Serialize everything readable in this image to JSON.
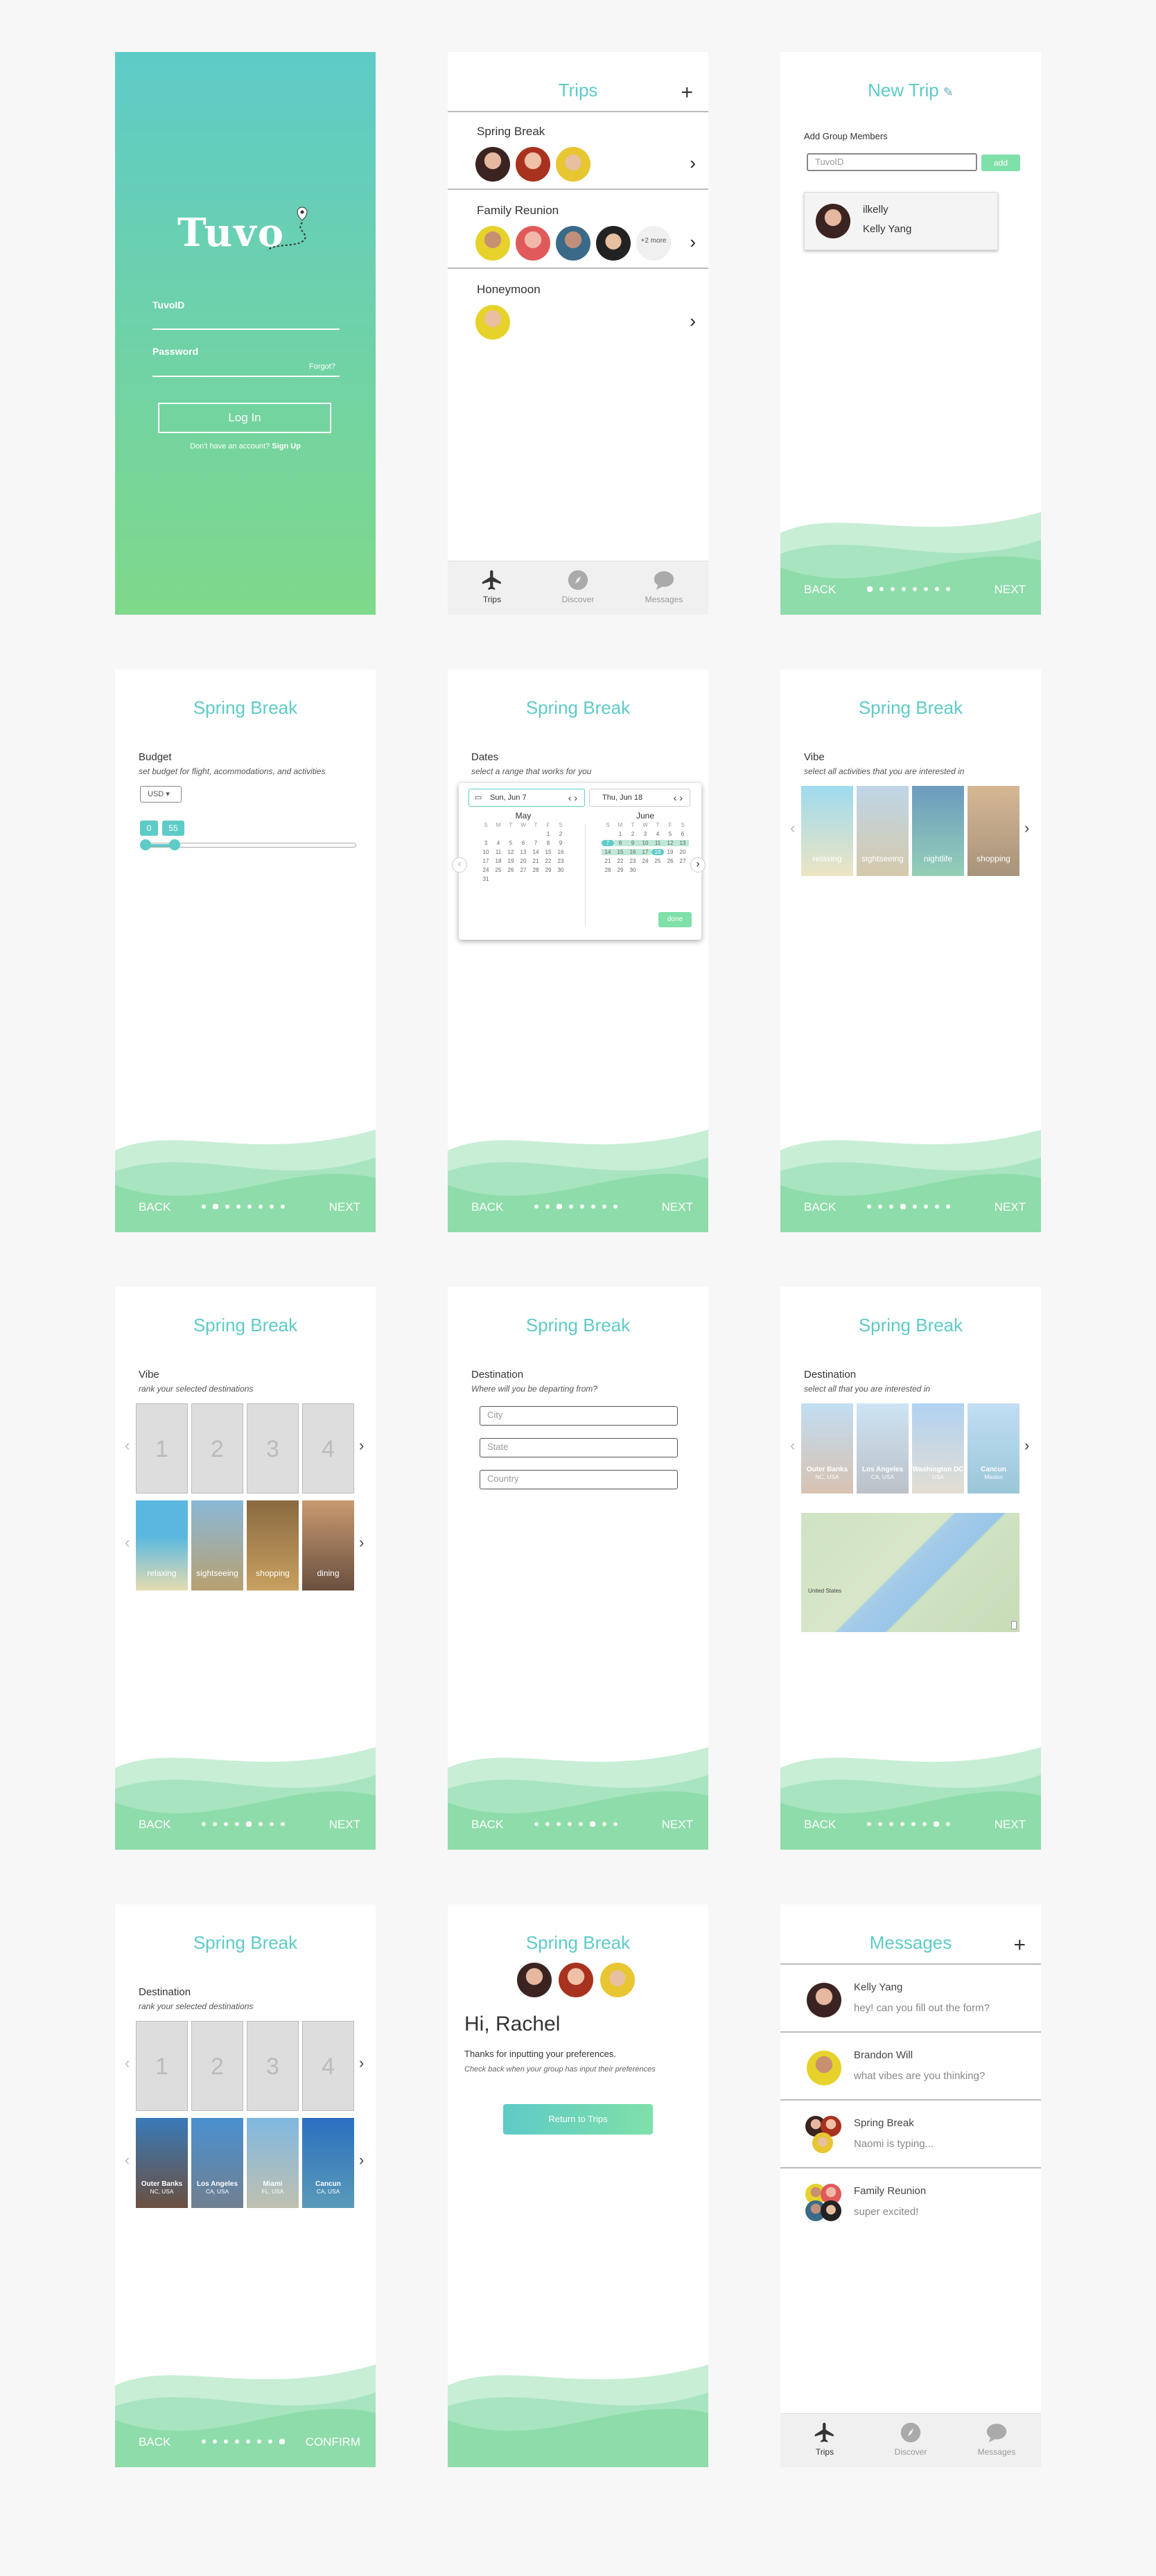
{
  "colors": {
    "teal": "#5ecbc7",
    "green": "#7fe0a9",
    "wave": "#8edcaa"
  },
  "login": {
    "logo": "Tuvo",
    "tuvoid_label": "TuvoID",
    "password_label": "Password",
    "forgot": "Forgot?",
    "login_btn": "Log In",
    "no_account": "Don't have an account?",
    "signup": "Sign Up"
  },
  "trips": {
    "title": "Trips",
    "plus": "+",
    "items": [
      {
        "name": "Spring Break"
      },
      {
        "name": "Family Reunion",
        "more": "+2 more"
      },
      {
        "name": "Honeymoon"
      }
    ]
  },
  "tabs": {
    "trips": "Trips",
    "discover": "Discover",
    "messages": "Messages"
  },
  "newtrip": {
    "title": "New Trip",
    "add_members": "Add Group Members",
    "placeholder": "TuvoID",
    "add": "add",
    "member_user": "ilkelly",
    "member_name": "Kelly Yang"
  },
  "nav": {
    "back": "BACK",
    "next": "NEXT",
    "confirm": "CONFIRM"
  },
  "trip_title": "Spring Break",
  "budget": {
    "label": "Budget",
    "sub": "set budget for flight, acommodations, and activities",
    "currency": "USD",
    "min": "0",
    "max": "55",
    "fill_fraction": 0.12
  },
  "dates": {
    "label": "Dates",
    "sub": "select a range that works for you",
    "start": "Sun, Jun 7",
    "end": "Thu, Jun 18",
    "month1": "May",
    "month2": "June",
    "done": "done",
    "weekdays": [
      "S",
      "M",
      "T",
      "W",
      "T",
      "F",
      "S"
    ]
  },
  "vibe": {
    "label": "Vibe",
    "sub": "select all activities that you are interested in",
    "tiles": [
      "relaxing",
      "sightseeing",
      "nightlife",
      "shopping"
    ]
  },
  "vibe_rank": {
    "label": "Vibe",
    "sub": "rank your selected destinations",
    "ranks": [
      "1",
      "2",
      "3",
      "4"
    ],
    "tiles": [
      "relaxing",
      "sightseeing",
      "shopping",
      "dining"
    ]
  },
  "depart": {
    "label": "Destination",
    "sub": "Where will you be departing from?",
    "city": "City",
    "state": "State",
    "country": "Country"
  },
  "dest": {
    "label": "Destination",
    "sub": "select all that you are interested in",
    "tiles": [
      {
        "name": "Outer Banks",
        "loc": "NC, USA"
      },
      {
        "name": "Los Angeles",
        "loc": "CA, USA"
      },
      {
        "name": "Washington DC",
        "loc": "USA"
      },
      {
        "name": "Cancun",
        "loc": "Mexico"
      }
    ],
    "map_label": "United States"
  },
  "dest_rank": {
    "label": "Destination",
    "sub": "rank your selected destinations",
    "ranks": [
      "1",
      "2",
      "3",
      "4"
    ],
    "tiles": [
      {
        "name": "Outer Banks",
        "loc": "NC, USA"
      },
      {
        "name": "Los Angeles",
        "loc": "CA, USA"
      },
      {
        "name": "Miami",
        "loc": "FL, USA"
      },
      {
        "name": "Cancun",
        "loc": "CA, USA"
      }
    ]
  },
  "done": {
    "greeting": "Hi, Rachel",
    "thanks": "Thanks for inputting your preferences.",
    "check": "Check back when your group has input their preferences",
    "btn": "Return to Trips"
  },
  "messages": {
    "title": "Messages",
    "plus": "+",
    "items": [
      {
        "name": "Kelly Yang",
        "text": "hey! can you fill out the form?"
      },
      {
        "name": "Brandon Will",
        "text": "what vibes are you thinking?"
      },
      {
        "name": "Spring Break",
        "text": "Naomi is typing..."
      },
      {
        "name": "Family Reunion",
        "text": "super excited!"
      }
    ]
  }
}
